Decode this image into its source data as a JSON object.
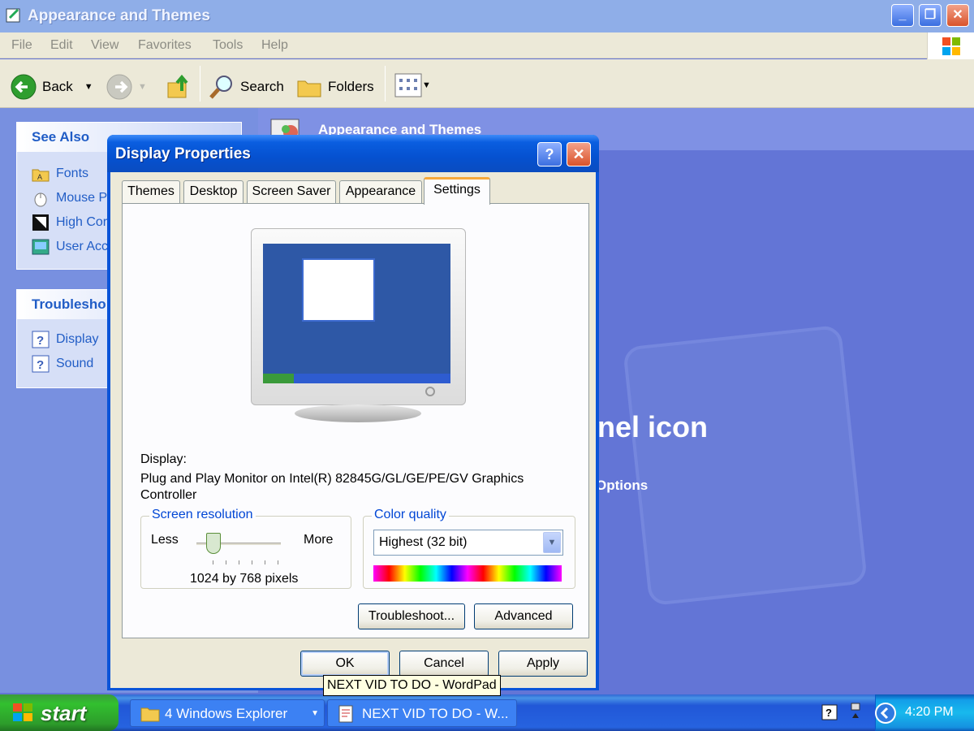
{
  "explorer": {
    "title": "Appearance and Themes",
    "menu": [
      "File",
      "Edit",
      "View",
      "Favorites",
      "Tools",
      "Help"
    ],
    "toolbar": {
      "back": "Back",
      "search": "Search",
      "folders": "Folders"
    },
    "see_also": {
      "title": "See Also",
      "items": [
        "Fonts",
        "Mouse P",
        "High Cor",
        "User Acc"
      ]
    },
    "troubleshooters": {
      "title": "Troublesho",
      "items": [
        "Display",
        "Sound"
      ]
    },
    "main": {
      "header": "Appearance and Themes",
      "big_text": "nel icon",
      "options_text": "Options"
    }
  },
  "dialog": {
    "title": "Display Properties",
    "help_label": "?",
    "tabs": [
      "Themes",
      "Desktop",
      "Screen Saver",
      "Appearance",
      "Settings"
    ],
    "active_tab": "Settings",
    "display_label": "Display:",
    "display_line1": "Plug and Play Monitor on Intel(R) 82845G/GL/GE/PE/GV Graphics",
    "display_line2": "Controller",
    "resolution": {
      "title": "Screen resolution",
      "less": "Less",
      "more": "More",
      "value": "1024 by 768 pixels",
      "slider_level": 0.2
    },
    "color_quality": {
      "title": "Color quality",
      "selected": "Highest (32 bit)"
    },
    "buttons": {
      "troubleshoot": "Troubleshoot...",
      "advanced": "Advanced",
      "ok": "OK",
      "cancel": "Cancel",
      "apply": "Apply"
    }
  },
  "tooltip": "NEXT VID TO DO - WordPad",
  "taskbar": {
    "start": "start",
    "buttons": [
      "4 Windows Explorer",
      "NEXT VID TO DO - W..."
    ],
    "clock": "4:20 PM"
  },
  "colors": {
    "xp_blue": "#0a54d8",
    "start_green": "#2d9d2b",
    "tab_highlight": "#f6a93b",
    "link_blue": "#215dc6"
  }
}
